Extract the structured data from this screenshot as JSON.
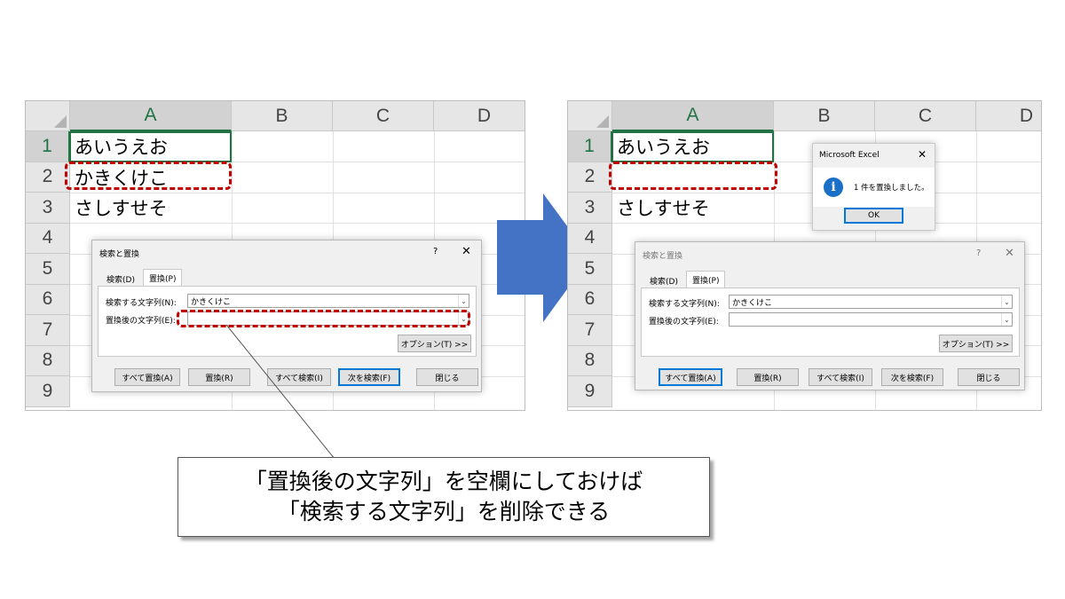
{
  "columns": [
    "A",
    "B",
    "C",
    "D"
  ],
  "rows": [
    "1",
    "2",
    "3",
    "4",
    "5",
    "6",
    "7",
    "8",
    "9"
  ],
  "left_sheet": {
    "cells": {
      "a1": "あいうえお",
      "a2": "かきくけこ",
      "a3": "さしすせそ"
    }
  },
  "right_sheet": {
    "cells": {
      "a1": "あいうえお",
      "a2": "",
      "a3": "さしすせそ"
    }
  },
  "dialog": {
    "title": "検索と置換",
    "help": "?",
    "close": "✕",
    "tabs": {
      "find": "検索(D)",
      "replace": "置換(P)"
    },
    "find_label": "検索する文字列(N):",
    "find_value": "かきくけこ",
    "replace_label": "置換後の文字列(E):",
    "replace_value": "",
    "options_button": "オプション(T) >>",
    "buttons": {
      "replace_all": "すべて置換(A)",
      "replace": "置換(R)",
      "find_all": "すべて検索(I)",
      "find_next": "次を検索(F)",
      "close": "閉じる"
    }
  },
  "msgbox": {
    "title": "Microsoft Excel",
    "close": "✕",
    "icon": "info-icon",
    "message": "1 件を置換しました。",
    "ok": "OK"
  },
  "callout": {
    "line1": "「置換後の文字列」を空欄にしておけば",
    "line2": "「検索する文字列」を削除できる"
  },
  "colors": {
    "arrow": "#4472c4",
    "highlight": "#c00000",
    "excel_green": "#217346"
  }
}
